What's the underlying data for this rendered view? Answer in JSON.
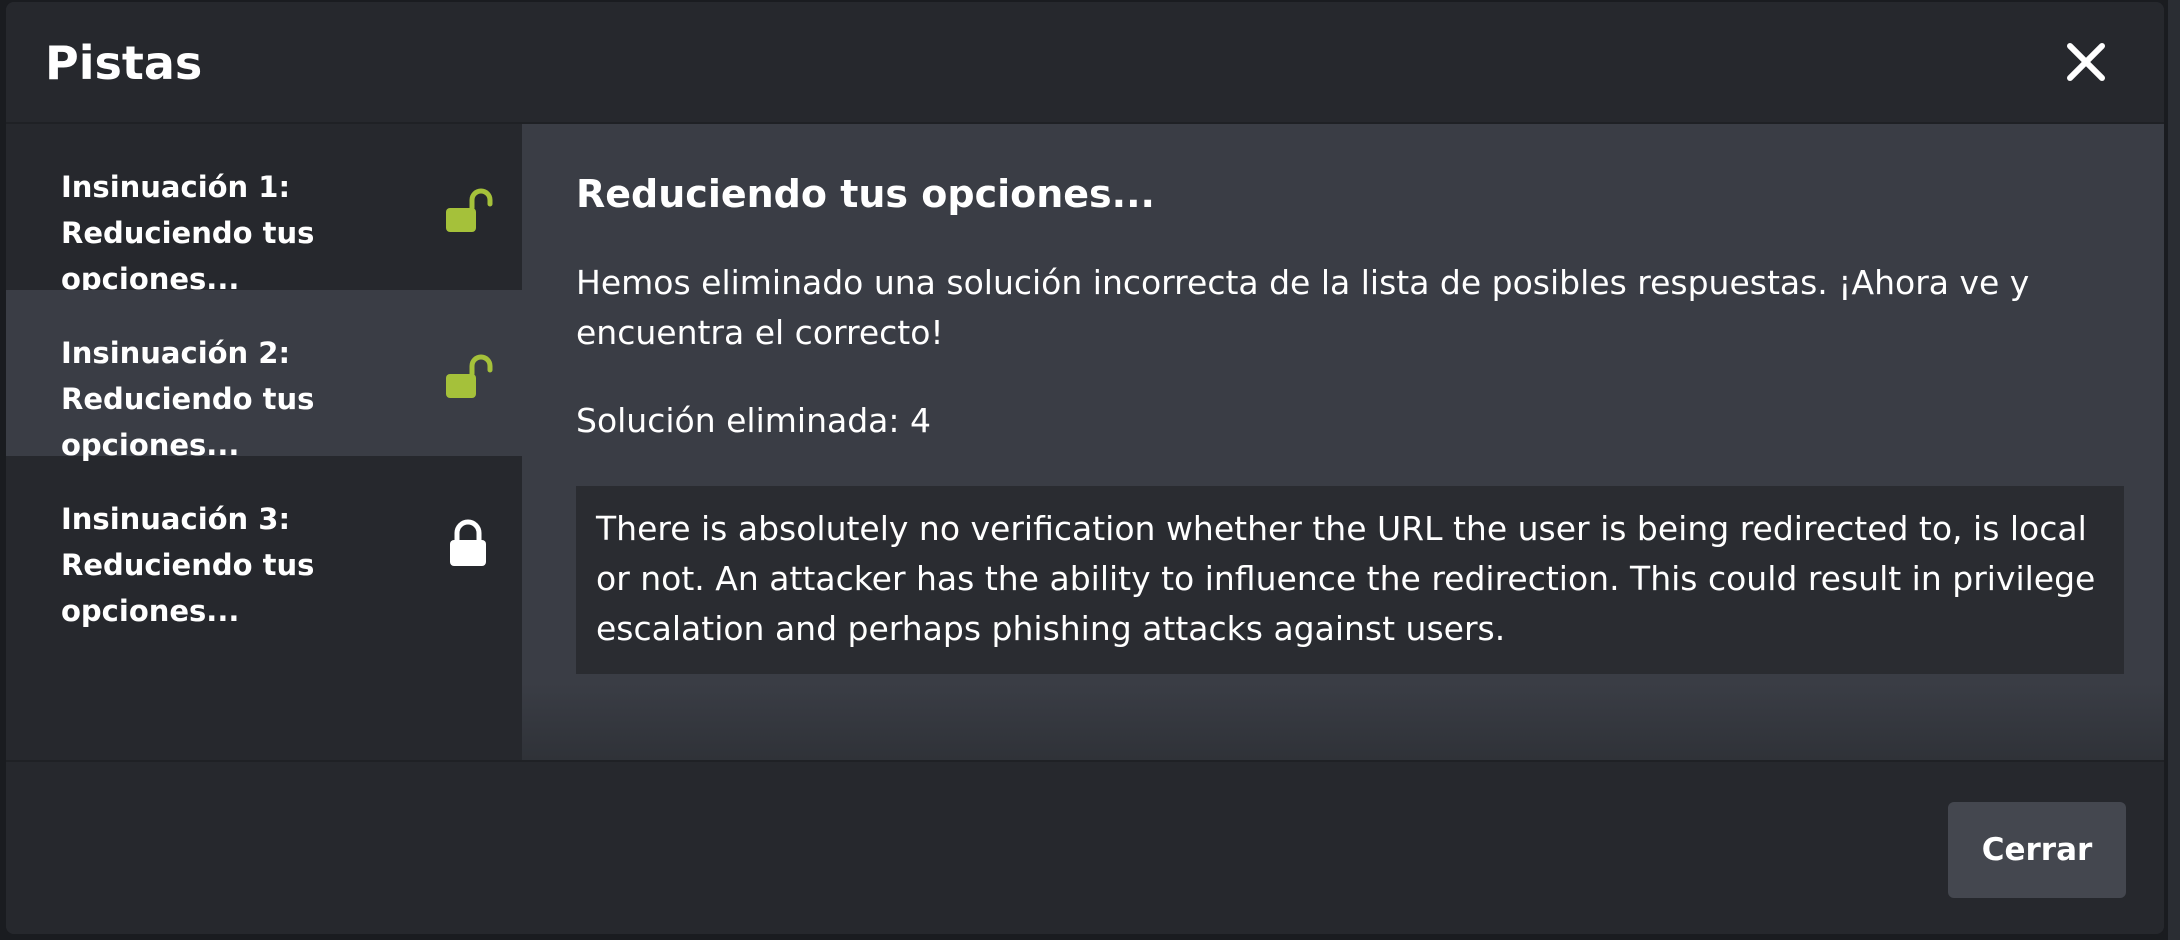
{
  "modal": {
    "title": "Pistas",
    "close_icon": "close-icon"
  },
  "hints": [
    {
      "label": "Insinuación 1: Reduciendo tus opciones...",
      "status": "unlocked",
      "icon": "unlocked-padlock-icon",
      "icon_color": "#a5c13a"
    },
    {
      "label": "Insinuación 2: Reduciendo tus opciones...",
      "status": "unlocked",
      "icon": "unlocked-padlock-icon",
      "icon_color": "#a5c13a",
      "selected": true
    },
    {
      "label": "Insinuación 3: Reduciendo tus opciones...",
      "status": "locked",
      "icon": "locked-padlock-icon",
      "icon_color": "#ffffff"
    }
  ],
  "content": {
    "title": "Reduciendo tus opciones...",
    "description": "Hemos eliminado una solución incorrecta de la lista de posibles respuestas. ¡Ahora ve y encuentra el correcto!",
    "solution_removed": "Solución eliminada: 4",
    "explanation": "There is absolutely no verification whether the URL the user is being redirected to, is local or not. An attacker has the ability to influence the redirection. This could result in privilege escalation and perhaps phishing attacks against users."
  },
  "footer": {
    "close_label": "Cerrar"
  },
  "colors": {
    "accent_unlocked": "#a5c13a",
    "panel_dark": "#26282d",
    "panel_light": "#3a3d45",
    "button": "#44474f"
  }
}
